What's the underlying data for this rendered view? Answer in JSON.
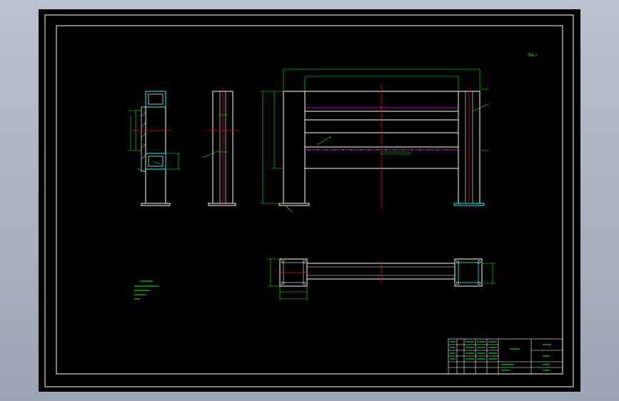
{
  "app": {
    "viewport_background": "#000000",
    "frame_color": "#ffffff"
  },
  "drawing": {
    "colors": {
      "outline": "#ffffff",
      "dimension": "#00ff00",
      "centerline": "#ff0000",
      "accent": "#ff00ff",
      "cyan": "#00ffff"
    },
    "roughness_symbol": "Ra √",
    "views": [
      {
        "name": "side-section-view"
      },
      {
        "name": "side-view"
      },
      {
        "name": "front-elevation-view"
      },
      {
        "name": "top-plan-view"
      }
    ],
    "title_block": {
      "visible": true
    }
  }
}
